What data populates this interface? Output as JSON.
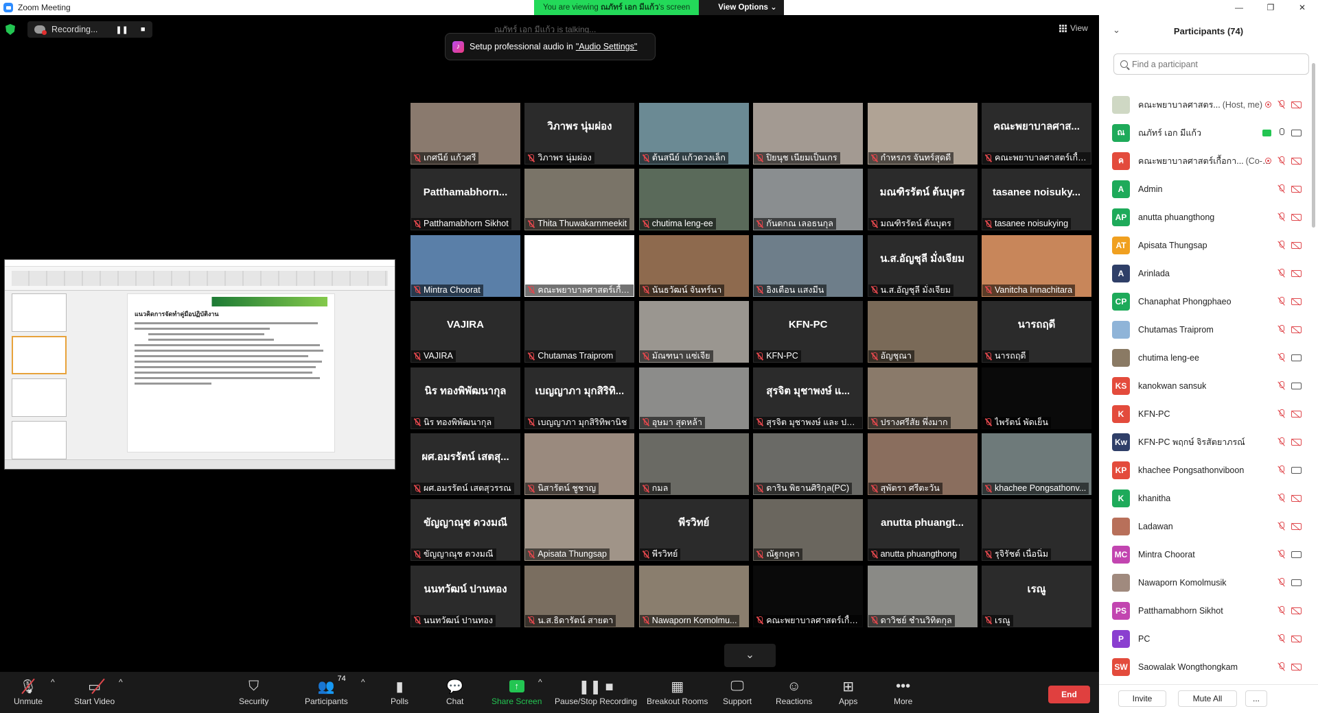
{
  "window": {
    "title": "Zoom Meeting"
  },
  "banner": {
    "prefix": "You are viewing ",
    "presenter": "ณภัทร์ เอก มีแก้ว",
    "suffix": "'s screen",
    "view_options": "View Options ⌄"
  },
  "recording": {
    "label": "Recording...",
    "pause": "❚❚",
    "stop": "■"
  },
  "talking": "ณภัทร์ เอก มีแก้ว is talking...",
  "audio_tip": {
    "prefix": "Setup professional audio in",
    "link": "\"Audio Settings\""
  },
  "view_button": "View",
  "shared_slide": {
    "title": "แนวคิดการจัดทำคู่มือปฏิบัติงาน"
  },
  "tiles": [
    {
      "big": "",
      "name": "เกศนีย์ แก้วศรี",
      "color": "#8a7a6e"
    },
    {
      "big": "วิภาพร นุ่มผ่อง",
      "name": "วิภาพร นุ่มผ่อง",
      "color": "#2b2b2b"
    },
    {
      "big": "",
      "name": "ต้นสนีย์ แก้วดวงเล็ก",
      "color": "#6b8a94"
    },
    {
      "big": "",
      "name": "ปิยนุช เนียมเป็นเกร",
      "color": "#a39a92"
    },
    {
      "big": "",
      "name": "กำหรภร จันทร์สุดดี",
      "color": "#b0a395"
    },
    {
      "big": "คณะพยาบาลศาส...",
      "name": "คณะพยาบาลศาสตร์เกื้อการุณย์",
      "color": "#2b2b2b"
    },
    {
      "big": "Patthamabhorn...",
      "name": "Patthamabhorn Sikhot",
      "color": "#2b2b2b"
    },
    {
      "big": "",
      "name": "Thita Thuwakarnmeekit",
      "color": "#7a7468"
    },
    {
      "big": "",
      "name": "chutima leng-ee",
      "color": "#5a6a5a"
    },
    {
      "big": "",
      "name": "กันตกณ เลอธนกุล",
      "color": "#8a8e90"
    },
    {
      "big": "มณฑิรรัตน์ ต้นบุตร",
      "name": "มณฑิรรัตน์ ต้นบุตร",
      "color": "#2b2b2b"
    },
    {
      "big": "tasanee noisuky...",
      "name": "tasanee noisukying",
      "color": "#2b2b2b"
    },
    {
      "big": "",
      "name": "Mintra Choorat",
      "color": "#5a7fa8"
    },
    {
      "big": "",
      "name": "คณะพยาบาลศาสตร์เกื้อก...",
      "color": "#ffffff"
    },
    {
      "big": "",
      "name": "นันธวัฒน์ จันทร์นา",
      "color": "#8e6a4e"
    },
    {
      "big": "",
      "name": "อิงเตือน แสงมีน",
      "color": "#6e7e8a"
    },
    {
      "big": "น.ส.อัญชุลี มั่งเจียม",
      "name": "น.ส.อัญชุลี มั่งเจียม",
      "color": "#2b2b2b"
    },
    {
      "big": "",
      "name": "Vanitcha Innachitara",
      "color": "#c8865a"
    },
    {
      "big": "VAJIRA",
      "name": "VAJIRA",
      "color": "#2b2b2b"
    },
    {
      "big": "",
      "name": "Chutamas Traiprom",
      "color": "#2b2b2b"
    },
    {
      "big": "",
      "name": "มัณฑนา แซ่เจีย",
      "color": "#9a9690"
    },
    {
      "big": "KFN-PC",
      "name": "KFN-PC",
      "color": "#2b2b2b"
    },
    {
      "big": "",
      "name": "อัญชุณา",
      "color": "#7a6a58"
    },
    {
      "big": "นารถฤดี",
      "name": "นารถฤดี",
      "color": "#2b2b2b"
    },
    {
      "big": "นิร ทองพิพัฒนากุล",
      "name": "นิร ทองพิพัฒนากุล",
      "color": "#2b2b2b"
    },
    {
      "big": "เบญญาภา มุกสิริทิ...",
      "name": "เบญญาภา มุกสิริทิพานิช",
      "color": "#2b2b2b"
    },
    {
      "big": "",
      "name": "อุษมา สุดหล้า",
      "color": "#8c8c8a"
    },
    {
      "big": "สุรจิต มุชาพงษ์ แ...",
      "name": "สุรจิต มุชาพงษ์ และ ปริณ...",
      "color": "#2b2b2b"
    },
    {
      "big": "",
      "name": "ปรางศรีสัย พึ่งมาก",
      "color": "#8a7a6a"
    },
    {
      "big": "",
      "name": "ไพรัตน์ พัดเย็น",
      "color": "#0a0a0a"
    },
    {
      "big": "ผศ.อมรรัตน์ เสตสุ...",
      "name": "ผศ.อมรรัตน์ เสตสุวรรณ",
      "color": "#2b2b2b"
    },
    {
      "big": "",
      "name": "นิสารัตน์ ชูชาญ",
      "color": "#9a8a7e"
    },
    {
      "big": "",
      "name": "กมล",
      "color": "#6a6a64"
    },
    {
      "big": "",
      "name": "ดาริน พิธานศิริกุล(PC)",
      "color": "#6a6a66"
    },
    {
      "big": "",
      "name": "สุพัตรา ศรีตะวัน",
      "color": "#8a6e5e"
    },
    {
      "big": "",
      "name": "khachee Pongsathonv...",
      "color": "#6e7a7a"
    },
    {
      "big": "ขัญญาณุช ดวงมณี",
      "name": "ขัญญาณุช ดวงมณี",
      "color": "#2b2b2b"
    },
    {
      "big": "",
      "name": "Apisata Thungsap",
      "color": "#a09488"
    },
    {
      "big": "พีรวิทย์",
      "name": "พีรวิทย์",
      "color": "#2b2b2b"
    },
    {
      "big": "",
      "name": "ณัฐกฤตา",
      "color": "#6a665e"
    },
    {
      "big": "anutta phuangt...",
      "name": "anutta phuangthong",
      "color": "#2b2b2b"
    },
    {
      "big": "",
      "name": "รุจิรัชต์ เนื่อนิ่ม",
      "color": "#2b2b2b"
    },
    {
      "big": "นนทวัฒน์ ปานทอง",
      "name": "นนทวัฒน์ ปานทอง",
      "color": "#2b2b2b"
    },
    {
      "big": "",
      "name": "น.ส.ธิดารัตน์ สายตา",
      "color": "#7a6e60"
    },
    {
      "big": "",
      "name": "Nawaporn Komolmu...",
      "color": "#8a7e6e"
    },
    {
      "big": "",
      "name": "คณะพยาบาลศาสตร์เกื้อก...",
      "color": "#0a0a0a"
    },
    {
      "big": "",
      "name": "ดาวิชย์ ชำนวิทิตกุล",
      "color": "#8a8a86"
    },
    {
      "big": "เรณู",
      "name": "เรณู",
      "color": "#2b2b2b"
    }
  ],
  "toolbar": {
    "unmute": "Unmute",
    "start_video": "Start Video",
    "security": "Security",
    "participants": "Participants",
    "participants_count": "74",
    "polls": "Polls",
    "chat": "Chat",
    "share_screen": "Share Screen",
    "pause_recording": "Pause/Stop Recording",
    "breakout": "Breakout Rooms",
    "support": "Support",
    "reactions": "Reactions",
    "apps": "Apps",
    "more": "More",
    "end": "End"
  },
  "panel": {
    "title": "Participants (74)",
    "search_placeholder": "Find a participant",
    "invite": "Invite",
    "mute_all": "Mute All",
    "more": "...",
    "participants": [
      {
        "initials": "",
        "name": "คณะพยาบาลศาสตร...",
        "role": "(Host, me)",
        "color": "#cfd8c4",
        "mic": "off",
        "video": "off",
        "rec": true,
        "share": false
      },
      {
        "initials": "ณ",
        "name": "ณภัทร์ เอก มีแก้ว",
        "role": "",
        "color": "#1eaa5a",
        "mic": "on",
        "video": "on",
        "rec": false,
        "share": true
      },
      {
        "initials": "ค",
        "name": "คณะพยาบาลศาสตร์เกื้อกา...",
        "role": "(Co-host)",
        "color": "#e34b3c",
        "mic": "off",
        "video": "off",
        "rec": true,
        "share": false
      },
      {
        "initials": "A",
        "name": "Admin",
        "role": "",
        "color": "#1eaa5a",
        "mic": "off",
        "video": "off",
        "rec": false,
        "share": false
      },
      {
        "initials": "AP",
        "name": "anutta phuangthong",
        "role": "",
        "color": "#1eaa5a",
        "mic": "off",
        "video": "off",
        "rec": false,
        "share": false
      },
      {
        "initials": "AT",
        "name": "Apisata Thungsap",
        "role": "",
        "color": "#f0a020",
        "mic": "off",
        "video": "off",
        "rec": false,
        "share": false
      },
      {
        "initials": "A",
        "name": "Arinlada",
        "role": "",
        "color": "#2f3f68",
        "mic": "off",
        "video": "off",
        "rec": false,
        "share": false
      },
      {
        "initials": "CP",
        "name": "Chanaphat Phongphaeo",
        "role": "",
        "color": "#1eaa5a",
        "mic": "off",
        "video": "off",
        "rec": false,
        "share": false
      },
      {
        "initials": "",
        "name": "Chutamas Traiprom",
        "role": "",
        "color": "#8fb4d8",
        "mic": "off",
        "video": "off",
        "rec": false,
        "share": false
      },
      {
        "initials": "",
        "name": "chutima leng-ee",
        "role": "",
        "color": "#8a7a64",
        "mic": "off",
        "video": "on",
        "rec": false,
        "share": false
      },
      {
        "initials": "KS",
        "name": "kanokwan sansuk",
        "role": "",
        "color": "#e34b3c",
        "mic": "off",
        "video": "on",
        "rec": false,
        "share": false
      },
      {
        "initials": "K",
        "name": "KFN-PC",
        "role": "",
        "color": "#e34b3c",
        "mic": "off",
        "video": "off",
        "rec": false,
        "share": false
      },
      {
        "initials": "Kw",
        "name": "KFN-PC พฤกษ์ จิรสัตยาภรณ์",
        "role": "",
        "color": "#2f3f68",
        "mic": "off",
        "video": "off",
        "rec": false,
        "share": false
      },
      {
        "initials": "KP",
        "name": "khachee Pongsathonviboon",
        "role": "",
        "color": "#e34b3c",
        "mic": "off",
        "video": "on",
        "rec": false,
        "share": false
      },
      {
        "initials": "K",
        "name": "khanitha",
        "role": "",
        "color": "#1eaa5a",
        "mic": "off",
        "video": "off",
        "rec": false,
        "share": false
      },
      {
        "initials": "",
        "name": "Ladawan",
        "role": "",
        "color": "#b8705a",
        "mic": "off",
        "video": "off",
        "rec": false,
        "share": false
      },
      {
        "initials": "MC",
        "name": "Mintra Choorat",
        "role": "",
        "color": "#c245b0",
        "mic": "off",
        "video": "on",
        "rec": false,
        "share": false
      },
      {
        "initials": "",
        "name": "Nawaporn Komolmusik",
        "role": "",
        "color": "#a08a7e",
        "mic": "off",
        "video": "on",
        "rec": false,
        "share": false
      },
      {
        "initials": "PS",
        "name": "Patthamabhorn Sikhot",
        "role": "",
        "color": "#c245b0",
        "mic": "off",
        "video": "off",
        "rec": false,
        "share": false
      },
      {
        "initials": "P",
        "name": "PC",
        "role": "",
        "color": "#8a3fd0",
        "mic": "off",
        "video": "off",
        "rec": false,
        "share": false
      },
      {
        "initials": "SW",
        "name": "Saowalak Wongthongkam",
        "role": "",
        "color": "#e34b3c",
        "mic": "off",
        "video": "off",
        "rec": false,
        "share": false
      }
    ]
  }
}
